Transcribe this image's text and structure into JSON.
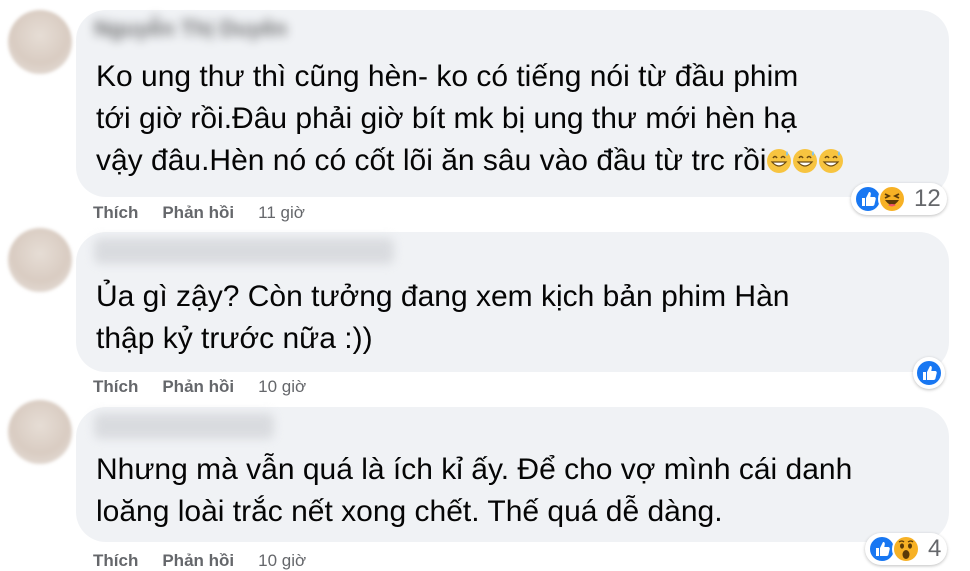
{
  "comments": [
    {
      "author": "Nguyễn Thị Duyên",
      "lines": [
        "Ko ung thư thì cũng hèn- ko có tiếng nói từ đầu phim",
        "tới giờ rồi.Đâu phải giờ bít mk bị ung thư mới hèn hạ",
        "vậy đâu.Hèn nó có cốt lõi ăn sâu vào đầu từ trc rồi"
      ],
      "inline_emoji": [
        "grinning-sweat-icon",
        "grinning-sweat-icon",
        "grinning-sweat-icon"
      ],
      "like_label": "Thích",
      "reply_label": "Phản hồi",
      "time": "11 giờ",
      "reaction_icons": [
        "like-icon",
        "haha-icon"
      ],
      "reaction_count": "12"
    },
    {
      "author": "",
      "lines": [
        "Ủa gì zậy? Còn tưởng đang xem kịch bản phim Hàn",
        "thập kỷ trước nữa :))"
      ],
      "like_label": "Thích",
      "reply_label": "Phản hồi",
      "time": "10 giờ",
      "reaction_icons": [
        "like-icon"
      ],
      "reaction_count": ""
    },
    {
      "author": "",
      "lines": [
        "Nhưng mà vẫn quá là ích kỉ ấy. Để cho vợ mình cái danh",
        "loăng loài trắc nết xong chết. Thế quá dễ dàng."
      ],
      "like_label": "Thích",
      "reply_label": "Phản hồi",
      "time": "10 giờ",
      "reaction_icons": [
        "like-icon",
        "wow-icon"
      ],
      "reaction_count": "4"
    }
  ],
  "colors": {
    "bubble": "#f0f2f5",
    "text": "#050505",
    "meta": "#65676b",
    "like_blue": "#1877f2",
    "emoji_yellow": "#f7b125"
  }
}
